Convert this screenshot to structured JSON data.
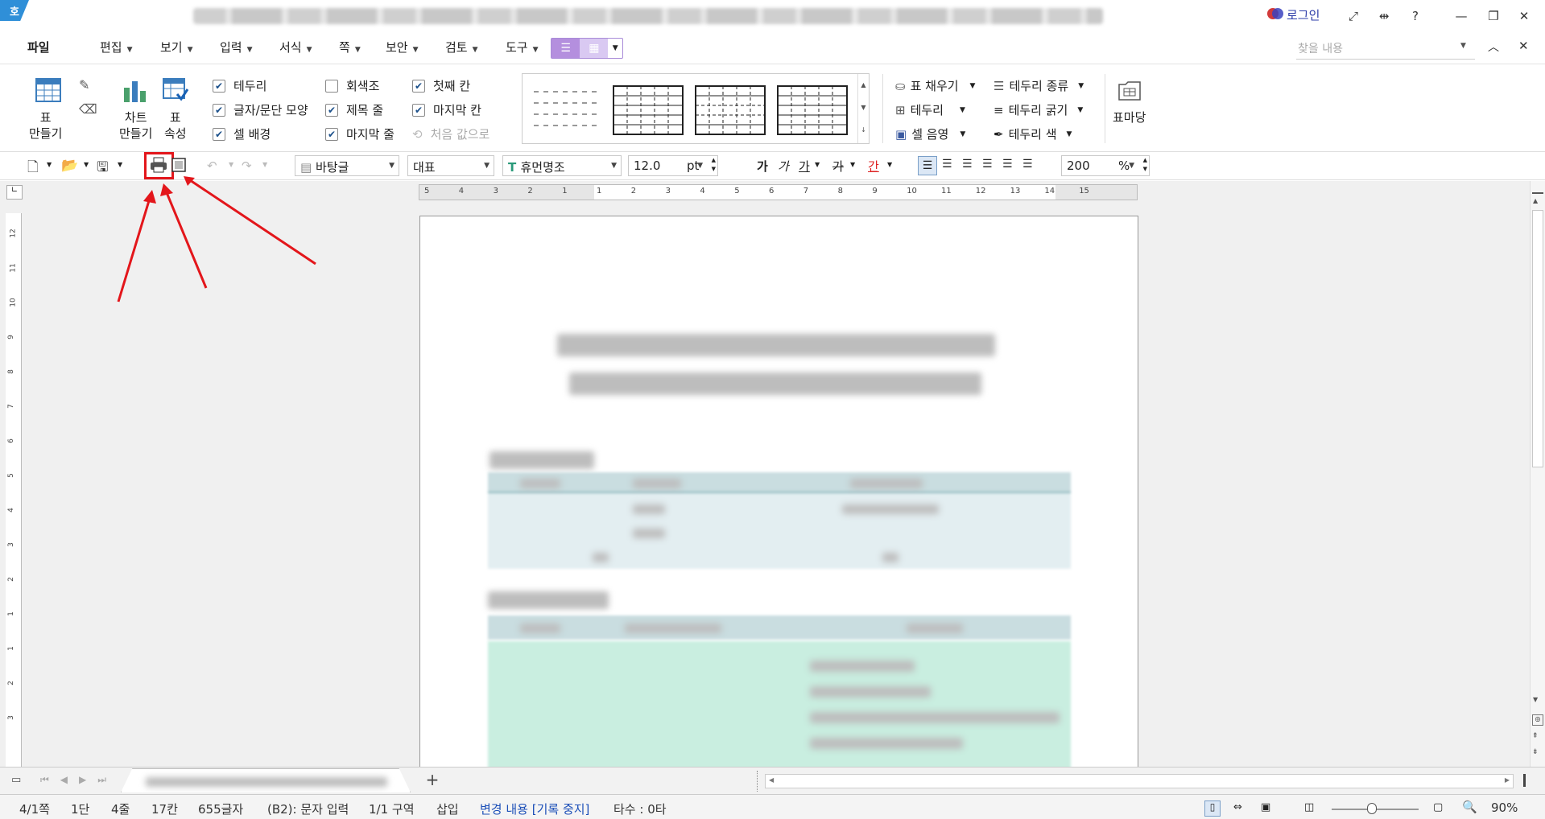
{
  "titlebar": {
    "logo": "호",
    "login": "로그인",
    "help": "?"
  },
  "menu": [
    {
      "label": "파일"
    },
    {
      "label": "편집"
    },
    {
      "label": "보기"
    },
    {
      "label": "입력"
    },
    {
      "label": "서식"
    },
    {
      "label": "쪽"
    },
    {
      "label": "보안"
    },
    {
      "label": "검토"
    },
    {
      "label": "도구"
    }
  ],
  "search": {
    "placeholder": "찾을 내용"
  },
  "ribbon": {
    "table_make": "표\n만들기",
    "chart_make": "차트\n만들기",
    "table_props": "표\n속성",
    "checks": [
      {
        "label": "테두리",
        "checked": true
      },
      {
        "label": "글자/문단 모양",
        "checked": true
      },
      {
        "label": "셀 배경",
        "checked": true
      },
      {
        "label": "회색조",
        "checked": false
      },
      {
        "label": "제목 줄",
        "checked": true
      },
      {
        "label": "마지막 줄",
        "checked": true
      },
      {
        "label": "첫째 칸",
        "checked": true
      },
      {
        "label": "마지막 칸",
        "checked": true
      },
      {
        "label": "처음 값으로",
        "checked": false,
        "disabled": true
      }
    ],
    "right": [
      {
        "label": "표 채우기"
      },
      {
        "label": "테두리"
      },
      {
        "label": "셀 음영"
      },
      {
        "label": "테두리 종류"
      },
      {
        "label": "테두리 굵기"
      },
      {
        "label": "테두리 색"
      }
    ],
    "table_madang": "표마당"
  },
  "toolbar": {
    "style": "바탕글",
    "rep": "대표",
    "font": "휴먼명조",
    "size": "12.0",
    "size_unit": "pt",
    "zoom": "200",
    "zoom_unit": "%",
    "char_buttons": [
      "가",
      "가",
      "가",
      "가",
      "간"
    ]
  },
  "ruler": {
    "h_ticks": [
      "5",
      "4",
      "3",
      "2",
      "1",
      "1",
      "2",
      "3",
      "4",
      "5",
      "6",
      "7",
      "8",
      "9",
      "10",
      "11",
      "12",
      "13",
      "14",
      "15"
    ],
    "v_ticks": [
      "12",
      "11",
      "10",
      "9",
      "8",
      "7",
      "6",
      "5",
      "4",
      "3",
      "2",
      "1",
      "1",
      "2",
      "3"
    ]
  },
  "status": {
    "page": "4/1쪽",
    "col": "1단",
    "line": "4줄",
    "cell": "17칸",
    "chars": "655글자",
    "mode": "(B2): 문자 입력",
    "section": "1/1 구역",
    "insert": "삽입",
    "track": "변경 내용 [기록 중지]",
    "typing": "타수 : 0타",
    "zoom": "90%"
  },
  "colors": {
    "accent": "#2f8fd8",
    "arrow": "#e3161b",
    "highlight_box": "#e3161b",
    "table_header": "#c9dde0",
    "table_body": "#c9eee0",
    "tool_purple": "#b48fde"
  }
}
